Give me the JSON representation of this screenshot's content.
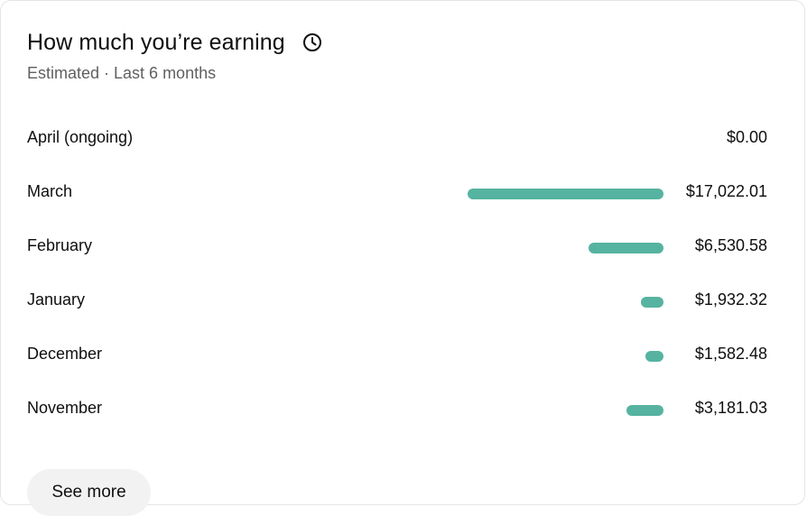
{
  "card": {
    "title": "How much you’re earning",
    "subtitle": "Estimated · Last 6 months",
    "see_more_label": "See more"
  },
  "colors": {
    "bar": "#56b3a1",
    "title_text": "#0f0f0f",
    "secondary_text": "#606060",
    "button_bg": "#f2f2f2"
  },
  "icons": {
    "title_icon": "clock-icon"
  },
  "earnings": [
    {
      "month": "April (ongoing)",
      "amount": "$0.00",
      "value": 0
    },
    {
      "month": "March",
      "amount": "$17,022.01",
      "value": 17022.01
    },
    {
      "month": "February",
      "amount": "$6,530.58",
      "value": 6530.58
    },
    {
      "month": "January",
      "amount": "$1,932.32",
      "value": 1932.32
    },
    {
      "month": "December",
      "amount": "$1,582.48",
      "value": 1582.48
    },
    {
      "month": "November",
      "amount": "$3,181.03",
      "value": 3181.03
    }
  ]
}
